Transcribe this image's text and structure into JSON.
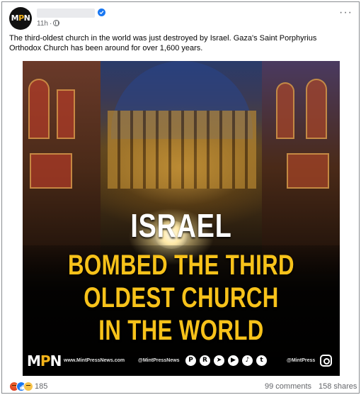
{
  "post": {
    "avatar_text_left": "M",
    "avatar_text_accent": "P",
    "avatar_text_right": "N",
    "time": "11h",
    "caption": "The third-oldest church in the world was just destroyed by Israel. Gaza's Saint Porphyrius Orthodox Church has been around for over 1,600 years.",
    "more_icon": "ellipsis-icon"
  },
  "media": {
    "headline_line1": "ISRAEL",
    "headline_line2": "BOMBED THE THIRD",
    "headline_line3": "OLDEST CHURCH",
    "headline_line4": "IN THE WORLD",
    "logo_left": "M",
    "logo_accent": "P",
    "logo_right": "N",
    "site": "www.MintPressNews.com",
    "handle1": "@MintPressNews",
    "handle2": "@MintPress",
    "social_icons": [
      "patreon-icon",
      "rumble-icon",
      "telegram-icon",
      "youtube-icon",
      "tiktok-icon",
      "twitter-icon",
      "instagram-icon"
    ],
    "colors": {
      "headline_white": "#ffffff",
      "headline_yellow": "#f7c21a"
    }
  },
  "footer": {
    "reactions": [
      "angry-icon",
      "like-icon",
      "sad-icon"
    ],
    "reaction_count": "185",
    "comments": "99 comments",
    "shares": "158 shares"
  }
}
